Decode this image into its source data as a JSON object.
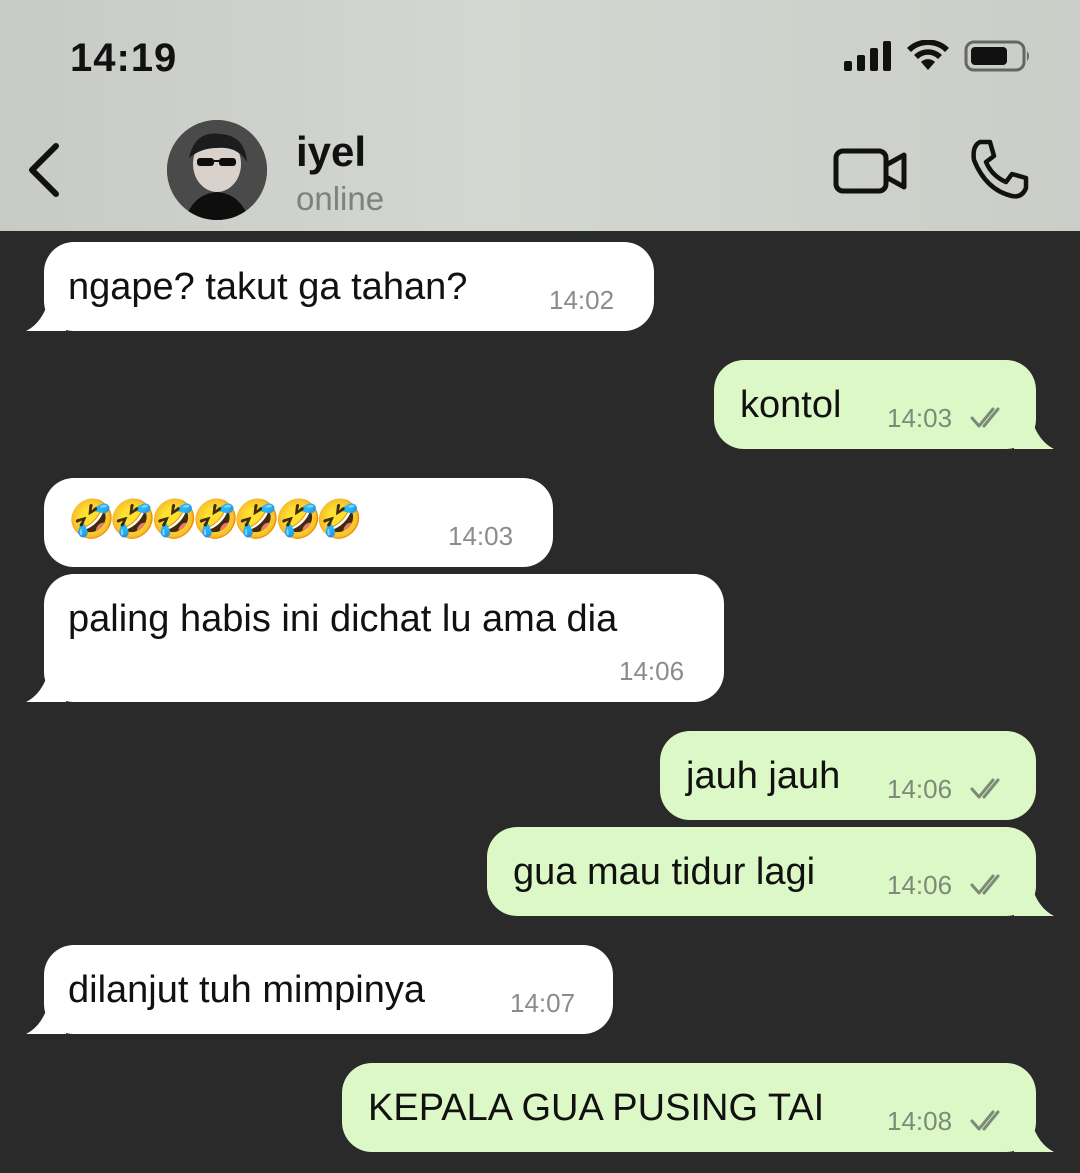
{
  "status_bar": {
    "time": "14:19",
    "icons": [
      "signal-icon",
      "wifi-icon",
      "battery-icon"
    ]
  },
  "header": {
    "back_icon": "chevron-left-icon",
    "contact_name": "iyel",
    "contact_status": "online",
    "video_call_icon": "video-camera-icon",
    "voice_call_icon": "phone-icon"
  },
  "colors": {
    "incoming_bubble": "#ffffff",
    "outgoing_bubble": "#dcf8c6",
    "chat_background": "#2a2a2a",
    "read_check": "#7d8a78"
  },
  "messages": [
    {
      "direction": "in",
      "text": "ngape? takut ga tahan?",
      "time": "14:02"
    },
    {
      "direction": "out",
      "text": "kontol",
      "time": "14:03",
      "status": "read"
    },
    {
      "direction": "in",
      "text": "🤣🤣🤣🤣🤣🤣🤣",
      "time": "14:03"
    },
    {
      "direction": "in",
      "text": "paling habis ini dichat lu ama dia",
      "time": "14:06"
    },
    {
      "direction": "out",
      "text": "jauh jauh",
      "time": "14:06",
      "status": "read"
    },
    {
      "direction": "out",
      "text": "gua mau tidur lagi",
      "time": "14:06",
      "status": "read"
    },
    {
      "direction": "in",
      "text": "dilanjut tuh mimpinya",
      "time": "14:07"
    },
    {
      "direction": "out",
      "text": "KEPALA GUA PUSING TAI",
      "time": "14:08",
      "status": "read"
    }
  ]
}
